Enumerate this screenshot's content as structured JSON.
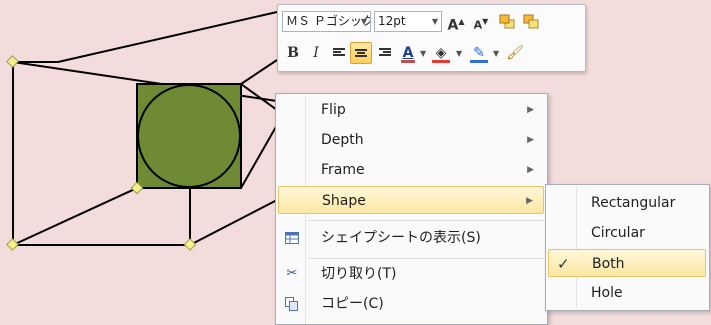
{
  "toolbar": {
    "font_name": "ＭＳ Ｐゴシック",
    "font_size": "12pt",
    "buttons": {
      "grow": "A",
      "shrink": "A",
      "bold": "B",
      "italic": "I",
      "font_color_letter": "A"
    },
    "colors": {
      "font_color": "#c0504d",
      "fill_color": "#e63b2e",
      "line_color": "#2f6fd6"
    }
  },
  "menu": {
    "items": [
      {
        "label": "Flip",
        "has_submenu": true
      },
      {
        "label": "Depth",
        "has_submenu": true
      },
      {
        "label": "Frame",
        "has_submenu": true
      },
      {
        "label": "Shape",
        "has_submenu": true,
        "highlighted": true
      },
      {
        "label": "シェイプシートの表示(S)",
        "icon": "sheet-icon"
      },
      {
        "label": "切り取り(T)",
        "icon": "scissors-icon"
      },
      {
        "label": "コピー(C)",
        "icon": "copy-icon"
      }
    ]
  },
  "submenu": {
    "items": [
      {
        "label": "Rectangular"
      },
      {
        "label": "Circular"
      },
      {
        "label": "Both",
        "checked": true,
        "highlighted": true
      },
      {
        "label": "Hole"
      }
    ],
    "check_mark": "✓"
  },
  "shape": {
    "fill_color": "#6e8a35",
    "stroke_color": "#000000",
    "handle_color": "#f5f08a"
  }
}
